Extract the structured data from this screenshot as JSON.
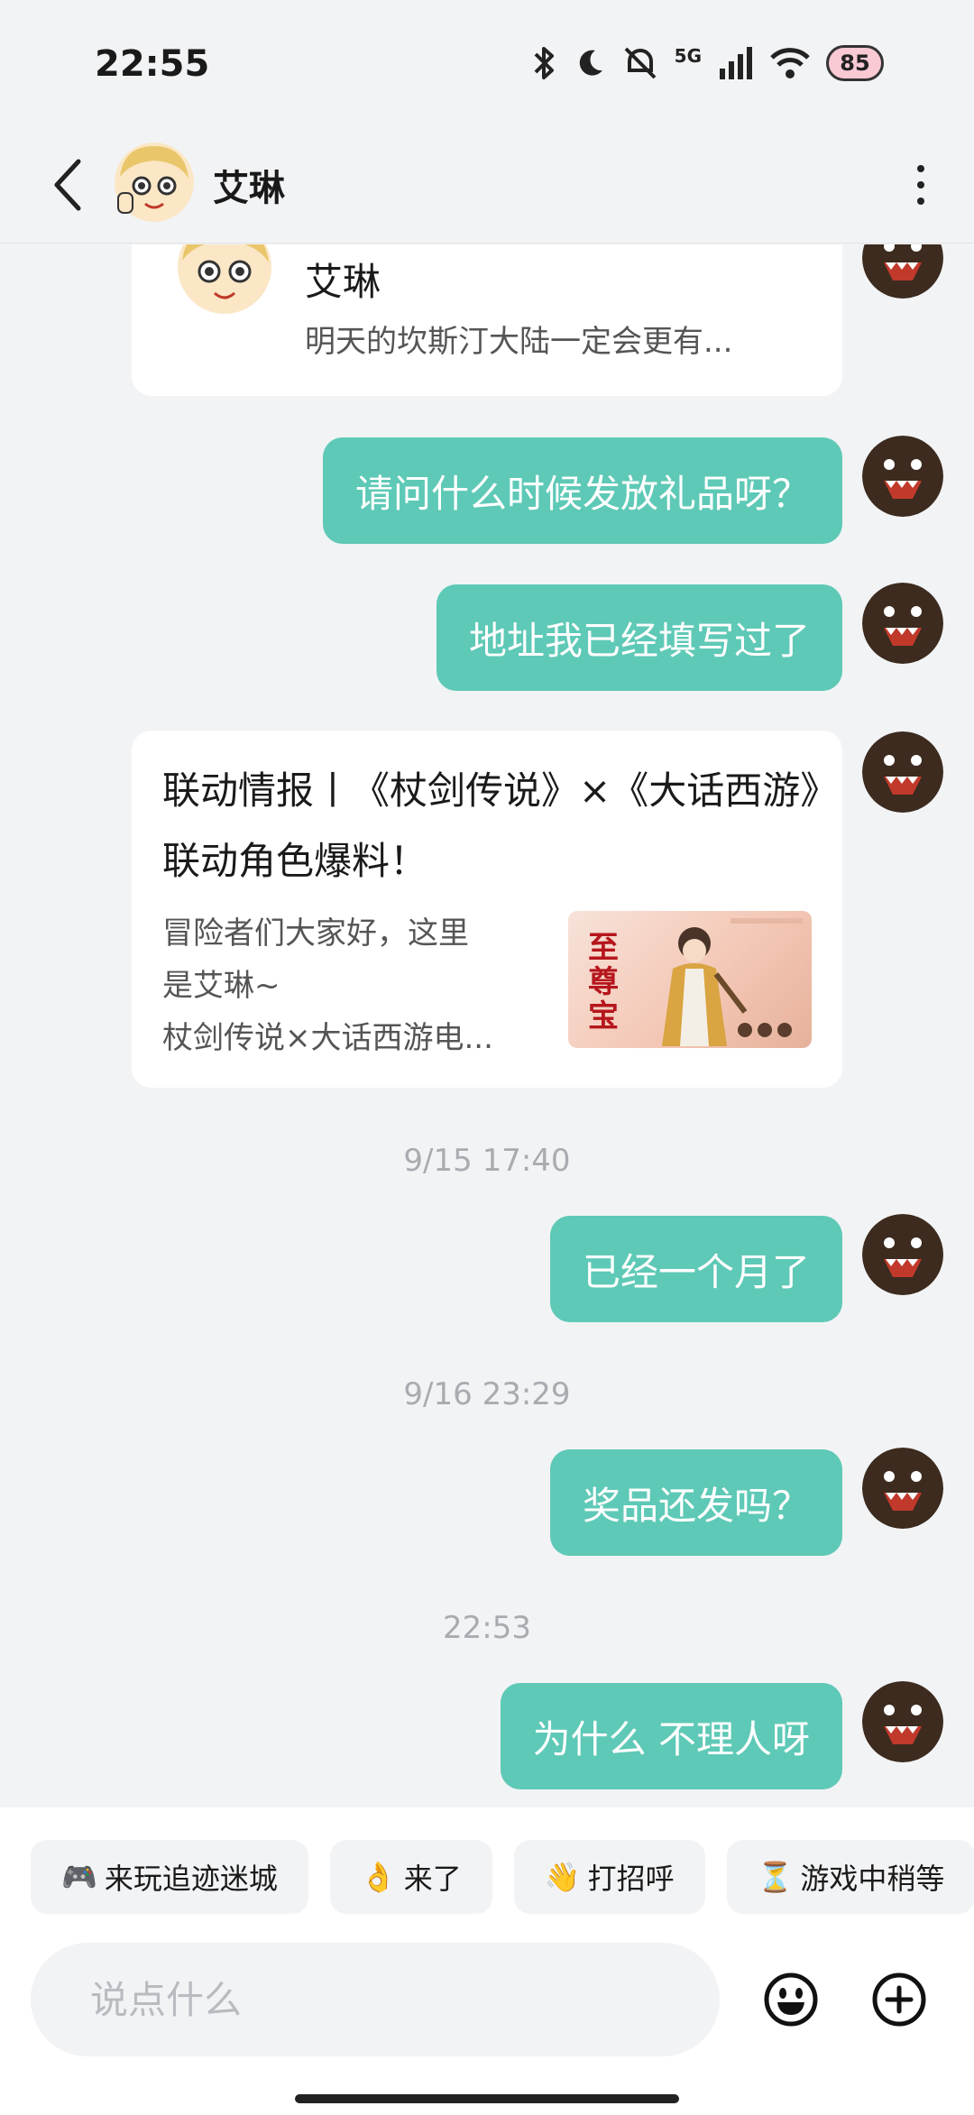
{
  "status_bar": {
    "time": "22:55",
    "network": "5G",
    "battery": "85",
    "icons": [
      "bluetooth-icon",
      "moon-icon",
      "mute-icon",
      "signal-icon",
      "wifi-icon",
      "battery-icon"
    ]
  },
  "header": {
    "contact_name": "艾琳"
  },
  "chat": {
    "share_card": {
      "title": "艾琳",
      "description": "明天的坎斯汀大陆一定会更有..."
    },
    "messages": [
      {
        "text": "请问什么时候发放礼品呀？"
      },
      {
        "text": "地址我已经填写过了"
      },
      {
        "text": "已经一个月了"
      },
      {
        "text": "奖品还发吗？"
      },
      {
        "text": "为什么 不理人呀"
      }
    ],
    "article": {
      "title": "联动情报丨《杖剑传说》×《大话西游》联动角色爆料！",
      "excerpt_lines": [
        "冒险者们大家好，这里",
        "是艾琳~",
        "杖剑传说×大话西游电..."
      ],
      "thumbnail_text": "至尊宝"
    },
    "timestamps": [
      "9/15  17:40",
      "9/16  23:29",
      "22:53"
    ]
  },
  "quick_replies": [
    {
      "emoji": "🎮",
      "label": "来玩追迹迷城"
    },
    {
      "emoji": "👌",
      "label": "来了"
    },
    {
      "emoji": "👋",
      "label": "打招呼"
    },
    {
      "emoji": "⏳",
      "label": "游戏中稍等"
    }
  ],
  "composer": {
    "placeholder": "说点什么"
  }
}
